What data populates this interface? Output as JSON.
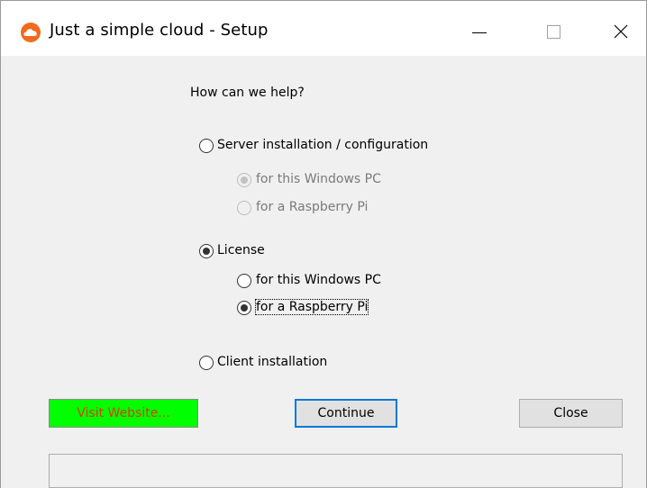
{
  "window": {
    "title": "Just a simple cloud - Setup",
    "icon": "cloud-icon",
    "accent_color": "#f26a1b"
  },
  "prompt": "How can we help?",
  "options": {
    "server": {
      "label": "Server installation / configuration",
      "selected": false,
      "sub": [
        {
          "label": "for this Windows PC",
          "selected": true,
          "enabled": false
        },
        {
          "label": "for a Raspberry Pi",
          "selected": false,
          "enabled": false
        }
      ]
    },
    "license": {
      "label": "License",
      "selected": true,
      "sub": [
        {
          "label": "for this Windows PC",
          "selected": false,
          "enabled": true
        },
        {
          "label": "for a Raspberry Pi",
          "selected": true,
          "enabled": true
        }
      ]
    },
    "client": {
      "label": "Client installation",
      "selected": false
    }
  },
  "buttons": {
    "visit": "Visit Website...",
    "continue": "Continue",
    "close": "Close"
  },
  "colors": {
    "visit_bg": "#00ff00",
    "visit_text": "#d44000",
    "focus_border": "#0078d7"
  }
}
